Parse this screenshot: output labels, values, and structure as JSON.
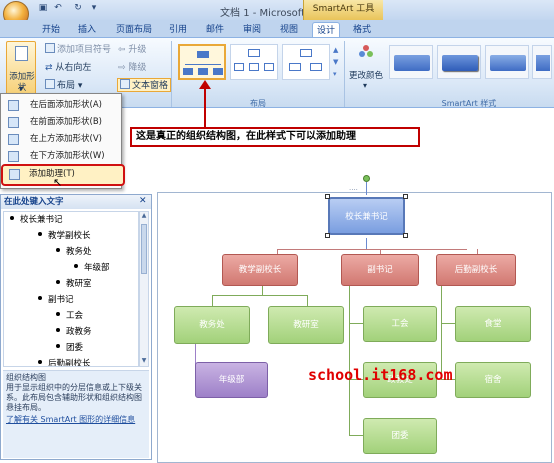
{
  "window": {
    "title": "文档 1 - Microsoft Word"
  },
  "context_tab": {
    "label": "SmartArt 工具"
  },
  "tabs": [
    "开始",
    "插入",
    "页面布局",
    "引用",
    "邮件",
    "审阅",
    "视图",
    "设计",
    "格式"
  ],
  "ribbon": {
    "add_shape": "添加形状",
    "add_bullet": "添加项目符号",
    "right_to_left": "从右向左",
    "layout": "布局",
    "promote": "升级",
    "demote": "降级",
    "text_pane": "文本窗格",
    "group_layout": "布局",
    "change_colors": "更改颜色",
    "group_styles": "SmartArt 样式"
  },
  "menu": {
    "items": [
      "在后面添加形状(A)",
      "在前面添加形状(B)",
      "在上方添加形状(V)",
      "在下方添加形状(W)",
      "添加助理(T)"
    ]
  },
  "callout": {
    "text": "这是真正的组织结构图，在此样式下可以添加助理"
  },
  "text_pane": {
    "title": "在此处键入文字",
    "items": [
      {
        "text": "校长兼书记",
        "level": 0
      },
      {
        "text": "教学副校长",
        "level": 1
      },
      {
        "text": "教务处",
        "level": 2
      },
      {
        "text": "年级部",
        "level": 3
      },
      {
        "text": "教研室",
        "level": 2
      },
      {
        "text": "副书记",
        "level": 1
      },
      {
        "text": "工会",
        "level": 2
      },
      {
        "text": "政教务",
        "level": 2
      },
      {
        "text": "团委",
        "level": 2
      },
      {
        "text": "后勤副校长",
        "level": 1
      }
    ],
    "desc_title": "组织结构图",
    "desc_body": "用于显示组织中的分层信息或上下级关系。此布局包含辅助形状和组织结构图悬挂布局。",
    "desc_link": "了解有关 SmartArt 图形的详细信息"
  },
  "chart": {
    "root": "校长兼书记",
    "level1": [
      "教学副校长",
      "副书记",
      "后勤副校长"
    ],
    "l2_left": [
      "教务处",
      "教研室"
    ],
    "l3": "年级部",
    "l2_mid": [
      "工会",
      "政教处",
      "团委"
    ],
    "l2_right": [
      "食堂",
      "宿舍"
    ]
  },
  "watermark": "school.it168.com"
}
